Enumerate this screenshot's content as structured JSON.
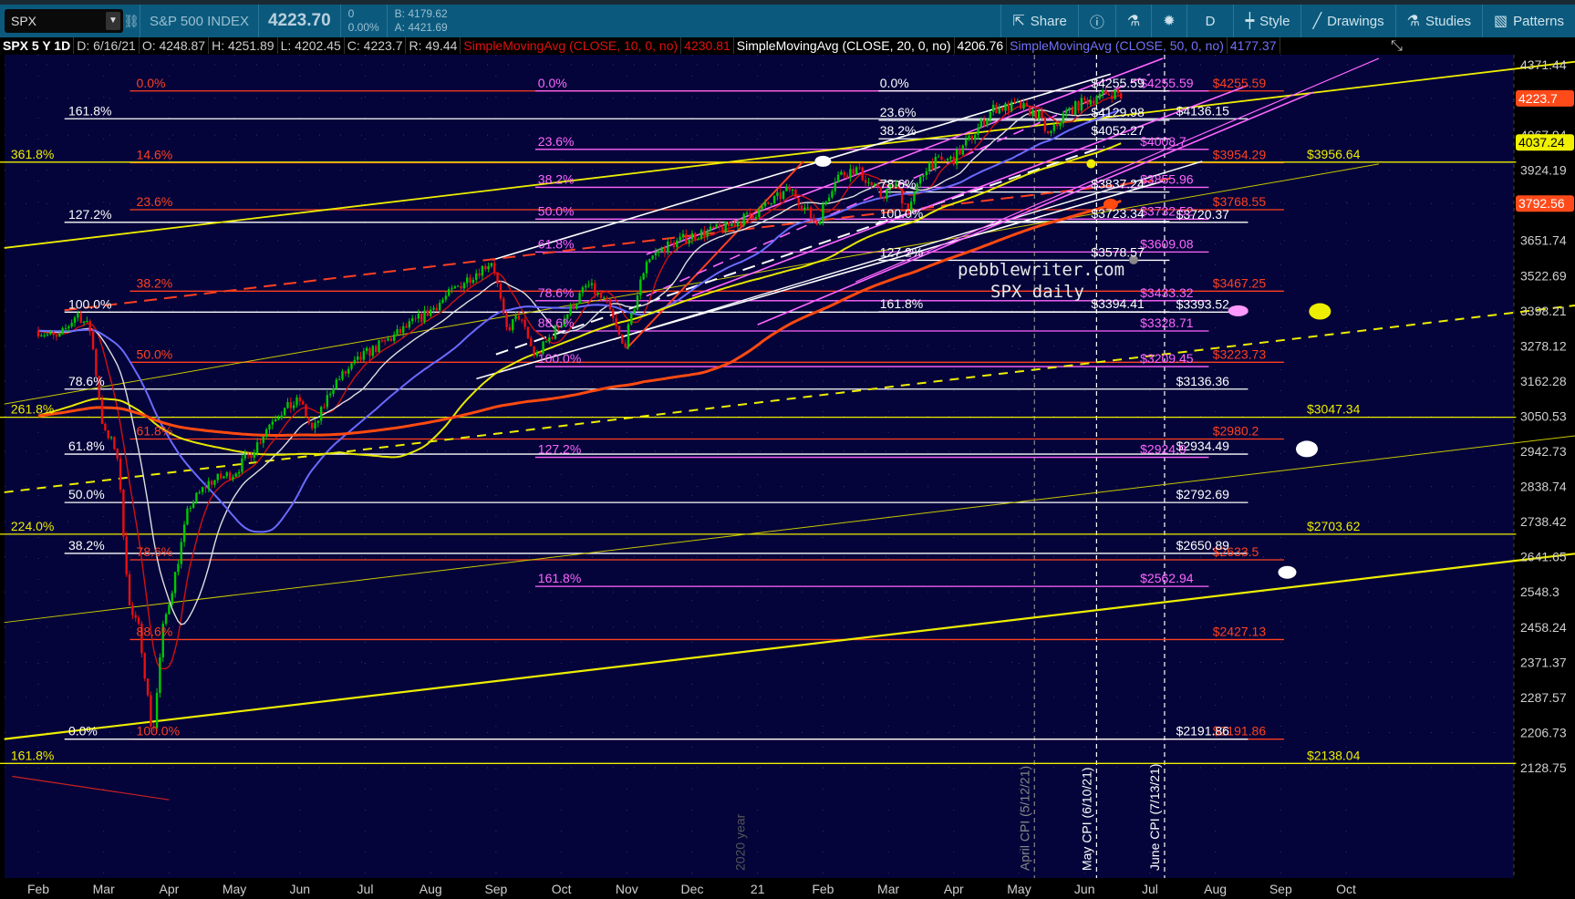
{
  "toolbar": {
    "symbol": "SPX",
    "name": "S&P 500 INDEX",
    "last": "4223.70",
    "change": "0",
    "change_pct": "0.00%",
    "bid": "B: 4179.62",
    "ask": "A: 4421.69",
    "buttons": [
      {
        "label": "Share",
        "icon": "share-icon"
      },
      {
        "label": "",
        "icon": "info-icon"
      },
      {
        "label": "",
        "icon": "flask-icon"
      },
      {
        "label": "",
        "icon": "gear-icon"
      },
      {
        "label": "D",
        "icon": ""
      },
      {
        "label": "Style",
        "icon": "candle-icon"
      },
      {
        "label": "Drawings",
        "icon": "pen-icon"
      },
      {
        "label": "Studies",
        "icon": "flask-icon"
      },
      {
        "label": "Patterns",
        "icon": "patterns-icon"
      }
    ]
  },
  "legend": {
    "title": "SPX 5 Y 1D",
    "date": "D: 6/16/21",
    "open": "O: 4248.87",
    "high": "H: 4251.89",
    "low": "L: 4202.45",
    "close": "C: 4223.7",
    "range": "R: 49.44",
    "sma10": "SimpleMovingAvg (CLOSE, 10, 0, no)",
    "sma10_val": "4230.81",
    "sma20": "SimpleMovingAvg (CLOSE, 20, 0, no)",
    "sma20_val": "4206.76",
    "sma50": "SimpleMovingAvg (CLOSE, 50, 0, no)",
    "sma50_val": "4177.37",
    "colors": {
      "sma10": "#e01010",
      "sma20": "#ffffff",
      "sma50": "#7070ff"
    }
  },
  "chart_data": {
    "type": "candlestick",
    "title": "SPX 5 Y 1D",
    "watermark": [
      "pebblewriter.com",
      "SPX daily"
    ],
    "scale": "log",
    "ylim": [
      2128.75,
      4371.44
    ],
    "y_ticks": [
      "4371.44",
      "4223.7",
      "4067.94",
      "3924.19",
      "3792.56",
      "3651.74",
      "3522.69",
      "3398.21",
      "3278.12",
      "3162.28",
      "3050.53",
      "2942.73",
      "2838.74",
      "2738.42",
      "2641.65",
      "2548.3",
      "2458.24",
      "2371.37",
      "2287.57",
      "2206.73",
      "2128.75"
    ],
    "x_ticks": [
      "Feb",
      "Mar",
      "Apr",
      "May",
      "Jun",
      "Jul",
      "Aug",
      "Sep",
      "Oct",
      "Nov",
      "Dec",
      "21",
      "Feb",
      "Mar",
      "Apr",
      "May",
      "Jun",
      "Jul",
      "Aug",
      "Sep",
      "Oct"
    ],
    "x_units": "months since Feb 2020",
    "price_markers": [
      {
        "value": "4223.7",
        "price": 4223.7,
        "color": "#ff4a1a",
        "text": "#fff"
      },
      {
        "value": "4037.24",
        "price": 4037.24,
        "color": "#f0f000",
        "text": "#000"
      },
      {
        "value": "3792.56",
        "price": 3792.56,
        "color": "#ff4a1a",
        "text": "#fff"
      }
    ],
    "price_path": [
      [
        0,
        3330
      ],
      [
        0.3,
        3300
      ],
      [
        0.6,
        3390
      ],
      [
        0.8,
        3330
      ],
      [
        1.0,
        3000
      ],
      [
        1.2,
        2950
      ],
      [
        1.4,
        2500
      ],
      [
        1.55,
        2450
      ],
      [
        1.75,
        2192
      ],
      [
        1.9,
        2450
      ],
      [
        2.1,
        2600
      ],
      [
        2.3,
        2780
      ],
      [
        2.6,
        2850
      ],
      [
        3.0,
        2880
      ],
      [
        3.3,
        2950
      ],
      [
        3.6,
        3050
      ],
      [
        4.0,
        3100
      ],
      [
        4.2,
        3000
      ],
      [
        4.5,
        3150
      ],
      [
        5.0,
        3250
      ],
      [
        5.5,
        3320
      ],
      [
        6.0,
        3400
      ],
      [
        6.5,
        3500
      ],
      [
        6.95,
        3580
      ],
      [
        7.15,
        3330
      ],
      [
        7.35,
        3380
      ],
      [
        7.6,
        3240
      ],
      [
        8.0,
        3360
      ],
      [
        8.4,
        3490
      ],
      [
        8.7,
        3420
      ],
      [
        8.95,
        3270
      ],
      [
        9.3,
        3580
      ],
      [
        9.6,
        3630
      ],
      [
        10.0,
        3670
      ],
      [
        10.5,
        3700
      ],
      [
        11.0,
        3760
      ],
      [
        11.5,
        3850
      ],
      [
        11.9,
        3714
      ],
      [
        12.2,
        3900
      ],
      [
        12.5,
        3930
      ],
      [
        12.9,
        3820
      ],
      [
        13.1,
        3870
      ],
      [
        13.3,
        3770
      ],
      [
        13.6,
        3950
      ],
      [
        14.0,
        3970
      ],
      [
        14.3,
        4070
      ],
      [
        14.6,
        4180
      ],
      [
        15.0,
        4190
      ],
      [
        15.3,
        4150
      ],
      [
        15.45,
        4060
      ],
      [
        15.7,
        4160
      ],
      [
        16.0,
        4210
      ],
      [
        16.3,
        4240
      ],
      [
        16.5,
        4250
      ],
      [
        16.55,
        4223.7
      ]
    ],
    "moving_averages": [
      {
        "name": "SMA 10",
        "period": 10,
        "color": "#d01010"
      },
      {
        "name": "SMA 20",
        "period": 20,
        "color": "#e0e0e0"
      },
      {
        "name": "SMA 50",
        "period": 50,
        "color": "#6a6aff"
      },
      {
        "name": "SMA 100",
        "period": 100,
        "color": "#e8e800"
      },
      {
        "name": "SMA 200",
        "period": 200,
        "color": "#ff4a10"
      }
    ],
    "fib_sets": [
      {
        "name": "red",
        "color": "#ff4020",
        "start": 1.4,
        "end": 19.05,
        "pct_at": 1.5,
        "price_at": 17.96,
        "levels": [
          {
            "pct": "0.0%",
            "price": 4255.59,
            "label": "$4255.59"
          },
          {
            "pct": "14.6%",
            "price": 3954.29,
            "label": "$3954.29"
          },
          {
            "pct": "23.6%",
            "price": 3768.55,
            "label": "$3768.55"
          },
          {
            "pct": "38.2%",
            "price": 3467.25,
            "label": "$3467.25"
          },
          {
            "pct": "50.0%",
            "price": 3223.73,
            "label": "$3223.73"
          },
          {
            "pct": "61.8%",
            "price": 2980.2,
            "label": "$2980.2"
          },
          {
            "pct": "78.6%",
            "price": 2633.5,
            "label": "$2633.5"
          },
          {
            "pct": "88.6%",
            "price": 2427.13,
            "label": "$2427.13"
          },
          {
            "pct": "100.0%",
            "price": 2191.86,
            "label": "$2191.86"
          }
        ]
      },
      {
        "name": "white",
        "color": "#ffffff",
        "start": 0.4,
        "end": 18.5,
        "pct_at": 0.46,
        "price_at": 17.4,
        "levels": [
          {
            "pct": "161.8%",
            "price": 4136.15,
            "label": "$4136.15"
          },
          {
            "pct": "127.2%",
            "price": 3720.37,
            "label": "$3720.37"
          },
          {
            "pct": "100.0%",
            "price": 3393.52,
            "label": "$3393.52"
          },
          {
            "pct": "78.6%",
            "price": 3136.36,
            "label": "$3136.36"
          },
          {
            "pct": "61.8%",
            "price": 2934.49,
            "label": "$2934.49"
          },
          {
            "pct": "50.0%",
            "price": 2792.69,
            "label": "$2792.69"
          },
          {
            "pct": "38.2%",
            "price": 2650.89,
            "label": "$2650.89"
          },
          {
            "pct": "0.0%",
            "price": 2191.86,
            "label": "$2191.86"
          }
        ]
      },
      {
        "name": "yellow",
        "color": "#eeee00",
        "start": -0.6,
        "end": 22.6,
        "pct_at": -0.42,
        "price_at": 19.4,
        "levels": [
          {
            "pct": "361.8%",
            "price": 3956.64,
            "label": "$3956.64"
          },
          {
            "pct": "261.8%",
            "price": 3047.34,
            "label": "$3047.34"
          },
          {
            "pct": "224.0%",
            "price": 2703.62,
            "label": "$2703.62"
          },
          {
            "pct": "161.8%",
            "price": 2138.04,
            "label": "$2138.04"
          }
        ]
      },
      {
        "name": "pink",
        "color": "#ff66ff",
        "start": 7.6,
        "end": 17.9,
        "pct_at": 7.64,
        "price_at": 16.85,
        "levels": [
          {
            "pct": "0.0%",
            "price": 4255.59,
            "label": "$4255.59"
          },
          {
            "pct": "23.6%",
            "price": 4008.7,
            "label": "$4008.7"
          },
          {
            "pct": "38.2%",
            "price": 3855.96,
            "label": "$3855.96"
          },
          {
            "pct": "50.0%",
            "price": 3732.52,
            "label": "$3732.52"
          },
          {
            "pct": "61.8%",
            "price": 3609.08,
            "label": "$3609.08"
          },
          {
            "pct": "78.6%",
            "price": 3433.32,
            "label": "$3433.32"
          },
          {
            "pct": "88.6%",
            "price": 3328.71,
            "label": "$3328.71"
          },
          {
            "pct": "100.0%",
            "price": 3209.45,
            "label": "$3209.45"
          },
          {
            "pct": "127.2%",
            "price": 2924.9,
            "label": "$2924.9"
          },
          {
            "pct": "161.8%",
            "price": 2562.94,
            "label": "$2562.94"
          }
        ]
      },
      {
        "name": "white2",
        "color": "#ffffff",
        "start": 12.85,
        "end": 17.3,
        "pct_at": 12.87,
        "price_at": 16.1,
        "levels": [
          {
            "pct": "0.0%",
            "price": 4255.59,
            "label": "$4255.59"
          },
          {
            "pct": "23.6%",
            "price": 4129.98,
            "label": "$4129.98"
          },
          {
            "pct": "38.2%",
            "price": 4052.27,
            "label": "$4052.27"
          },
          {
            "pct": "78.6%",
            "price": 3837.24,
            "label": "$3837.24"
          },
          {
            "pct": "100.0%",
            "price": 3723.34,
            "label": "$3723.34"
          },
          {
            "pct": "127.2%",
            "price": 3578.57,
            "label": "$3578.57"
          },
          {
            "pct": "161.8%",
            "price": 3394.41,
            "label": "$3394.41"
          }
        ]
      }
    ],
    "trendlines": [
      {
        "color": "#eeee00",
        "width": 2.2,
        "dash": "",
        "pts": [
          -0.52,
          2192,
          23.5,
          2650
        ]
      },
      {
        "color": "#eeee00",
        "width": 1.8,
        "dash": "",
        "pts": [
          -0.52,
          3624,
          23.5,
          4385
        ]
      },
      {
        "color": "#c8c800",
        "width": 1,
        "dash": "",
        "pts": [
          -0.52,
          2470,
          23.5,
          2990
        ]
      },
      {
        "color": "#eeee00",
        "width": 2,
        "dash": "10,8",
        "pts": [
          -0.52,
          2822,
          23.5,
          3417
        ]
      },
      {
        "color": "#c8c800",
        "width": 1,
        "dash": "",
        "pts": [
          -0.52,
          3089,
          20.5,
          3949
        ]
      },
      {
        "color": "#ffffff",
        "width": 1.6,
        "dash": "",
        "pts": [
          6.95,
          3580,
          16.4,
          4330
        ]
      },
      {
        "color": "#ffffff",
        "width": 1.6,
        "dash": "",
        "pts": [
          6.7,
          3170,
          17.2,
          3880
        ]
      },
      {
        "color": "#ffffff",
        "width": 1.4,
        "dash": "",
        "pts": [
          8.8,
          3300,
          17.8,
          3960
        ]
      },
      {
        "color": "#ffffff",
        "width": 2,
        "dash": "14,8",
        "pts": [
          7.0,
          3250,
          16.3,
          4020
        ]
      },
      {
        "color": "#ff4020",
        "width": 2,
        "dash": "14,8",
        "pts": [
          0.4,
          3400,
          17.3,
          3890
        ]
      },
      {
        "color": "#ff4020",
        "width": 2,
        "dash": "",
        "pts": [
          9.0,
          3270,
          11.7,
          3960
        ]
      },
      {
        "color": "#ff66ff",
        "width": 1.6,
        "dash": "",
        "pts": [
          9.3,
          3600,
          17.2,
          4400
        ]
      },
      {
        "color": "#ff66ff",
        "width": 1.6,
        "dash": "",
        "pts": [
          10.0,
          3450,
          18.5,
          4280
        ]
      },
      {
        "color": "#ff66ff",
        "width": 1.6,
        "dash": "",
        "pts": [
          11.0,
          3350,
          19.5,
          4250
        ]
      },
      {
        "color": "#ff66ff",
        "width": 1.6,
        "dash": "12,8",
        "pts": [
          9.3,
          3450,
          17.0,
          4330
        ]
      },
      {
        "color": "#ff66ff",
        "width": 1.2,
        "dash": "",
        "pts": [
          12.5,
          3500,
          20.5,
          4400
        ]
      },
      {
        "color": "#cc2020",
        "width": 1.2,
        "dash": "",
        "pts": [
          -0.4,
          2110,
          2.0,
          2060
        ]
      }
    ],
    "markers": [
      {
        "m": 12.0,
        "price": 3960,
        "color": "#ffffff",
        "rx": 9,
        "ry": 6
      },
      {
        "m": 16.1,
        "price": 3950,
        "color": "#eeee00",
        "rx": 5,
        "ry": 5
      },
      {
        "m": 16.4,
        "price": 3790,
        "color": "#ff4a10",
        "rx": 8,
        "ry": 6
      },
      {
        "m": 16.75,
        "price": 3580,
        "color": "#888888",
        "rx": 5,
        "ry": 5
      },
      {
        "m": 18.35,
        "price": 3398,
        "color": "#ff99ff",
        "rx": 11,
        "ry": 6
      },
      {
        "m": 19.6,
        "price": 3396,
        "color": "#eeee00",
        "rx": 12,
        "ry": 9
      },
      {
        "m": 19.4,
        "price": 2950,
        "color": "#ffffff",
        "rx": 12,
        "ry": 9
      },
      {
        "m": 19.1,
        "price": 2600,
        "color": "#ffffff",
        "rx": 10,
        "ry": 7
      }
    ],
    "events": [
      {
        "m": 15.15,
        "label": "April CPI (5/12/21)",
        "color": "#888888"
      },
      {
        "m": 16.1,
        "label": "May CPI (6/10/21)",
        "color": "#ffffff"
      },
      {
        "m": 17.14,
        "label": "June CPI (7/13/21)",
        "color": "#ffffff"
      },
      {
        "m": 10.8,
        "label": "2020 year",
        "color": "#555555",
        "nodash": true
      }
    ]
  }
}
